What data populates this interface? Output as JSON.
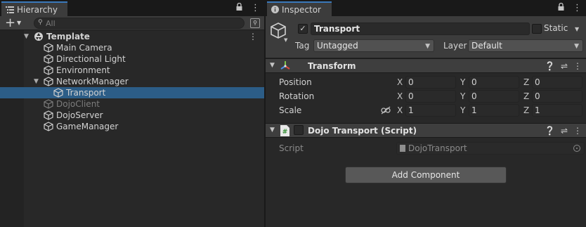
{
  "hierarchy": {
    "tab_label": "Hierarchy",
    "search_placeholder": "All",
    "items": [
      {
        "label": "Template",
        "bold": true,
        "disabled": false,
        "depth": 0
      },
      {
        "label": "Main Camera",
        "bold": false,
        "disabled": false,
        "depth": 1
      },
      {
        "label": "Directional Light",
        "bold": false,
        "disabled": false,
        "depth": 1
      },
      {
        "label": "Environment",
        "bold": false,
        "disabled": false,
        "depth": 1
      },
      {
        "label": "NetworkManager",
        "bold": false,
        "disabled": false,
        "depth": 1
      },
      {
        "label": "Transport",
        "bold": false,
        "disabled": false,
        "depth": 2,
        "selected": true
      },
      {
        "label": "DojoClient",
        "bold": false,
        "disabled": true,
        "depth": 1
      },
      {
        "label": "DojoServer",
        "bold": false,
        "disabled": false,
        "depth": 1
      },
      {
        "label": "GameManager",
        "bold": false,
        "disabled": false,
        "depth": 1
      }
    ]
  },
  "inspector": {
    "tab_label": "Inspector",
    "object_name": "Transport",
    "static_label": "Static",
    "tag_label": "Tag",
    "tag_value": "Untagged",
    "layer_label": "Layer",
    "layer_value": "Default",
    "transform": {
      "title": "Transform",
      "position_label": "Position",
      "rotation_label": "Rotation",
      "scale_label": "Scale",
      "axis_x": "X",
      "axis_y": "Y",
      "axis_z": "Z",
      "position": {
        "x": "0",
        "y": "0",
        "z": "0"
      },
      "rotation": {
        "x": "0",
        "y": "0",
        "z": "0"
      },
      "scale": {
        "x": "1",
        "y": "1",
        "z": "1"
      }
    },
    "script_component": {
      "title": "Dojo Transport (Script)",
      "script_label": "Script",
      "script_value": "DojoTransport"
    },
    "add_component_label": "Add Component"
  },
  "colors": {
    "panel_bg": "#282828",
    "header_bg": "#3c3c3c",
    "selection": "#2c5d87",
    "tab_accent": "#3a79bb"
  },
  "icons": [
    "hierarchy-list-icon",
    "lock-icon",
    "kebab-icon",
    "search-icon",
    "unity-scene-icon",
    "cube-icon",
    "transform-axes-icon",
    "csharp-script-icon",
    "help-icon",
    "preset-icon",
    "constrain-proportions-icon"
  ]
}
